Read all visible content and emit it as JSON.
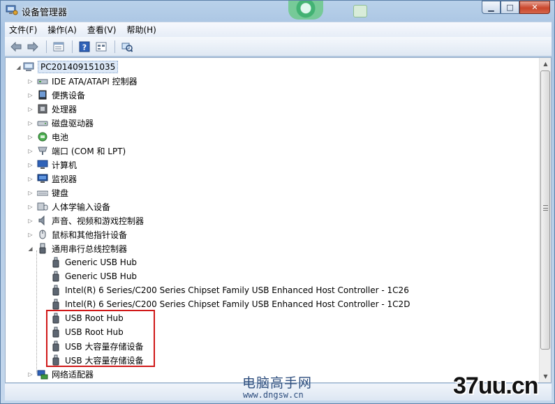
{
  "window": {
    "title": "设备管理器",
    "caption_minimize": "▁",
    "caption_maximize": "□",
    "caption_close": "✕"
  },
  "menubar": {
    "items": [
      "文件(F)",
      "操作(A)",
      "查看(V)",
      "帮助(H)"
    ]
  },
  "toolbar": {
    "icons": [
      "back-arrow-icon",
      "forward-arrow-icon",
      "properties-icon",
      "help-icon",
      "view-icon",
      "scan-hardware-icon"
    ]
  },
  "tree": {
    "root": "PC201409151035",
    "categories": [
      {
        "label": "IDE ATA/ATAPI 控制器",
        "icon": "ide-controller-icon"
      },
      {
        "label": "便携设备",
        "icon": "portable-device-icon"
      },
      {
        "label": "处理器",
        "icon": "processor-icon"
      },
      {
        "label": "磁盘驱动器",
        "icon": "disk-drive-icon"
      },
      {
        "label": "电池",
        "icon": "battery-icon"
      },
      {
        "label": "端口 (COM 和 LPT)",
        "icon": "port-icon"
      },
      {
        "label": "计算机",
        "icon": "computer-icon"
      },
      {
        "label": "监视器",
        "icon": "monitor-icon"
      },
      {
        "label": "键盘",
        "icon": "keyboard-icon"
      },
      {
        "label": "人体学输入设备",
        "icon": "hid-icon"
      },
      {
        "label": "声音、视频和游戏控制器",
        "icon": "sound-icon"
      },
      {
        "label": "鼠标和其他指针设备",
        "icon": "mouse-icon"
      },
      {
        "label": "通用串行总线控制器",
        "icon": "usb-icon"
      }
    ],
    "usb_children": [
      "Generic USB Hub",
      "Generic USB Hub",
      "Intel(R) 6 Series/C200 Series Chipset Family USB Enhanced Host Controller - 1C26",
      "Intel(R) 6 Series/C200 Series Chipset Family USB Enhanced Host Controller - 1C2D",
      "USB Root Hub",
      "USB Root Hub",
      "USB 大容量存储设备",
      "USB 大容量存储设备"
    ],
    "after": "网络适配器"
  },
  "watermark": {
    "site_cn": "电脑高手网",
    "site_url": "www.dngsw.cn",
    "brand": "37uu.cn"
  },
  "colors": {
    "highlight_box": "#d01818",
    "selection_bg": "#dce8f7"
  }
}
